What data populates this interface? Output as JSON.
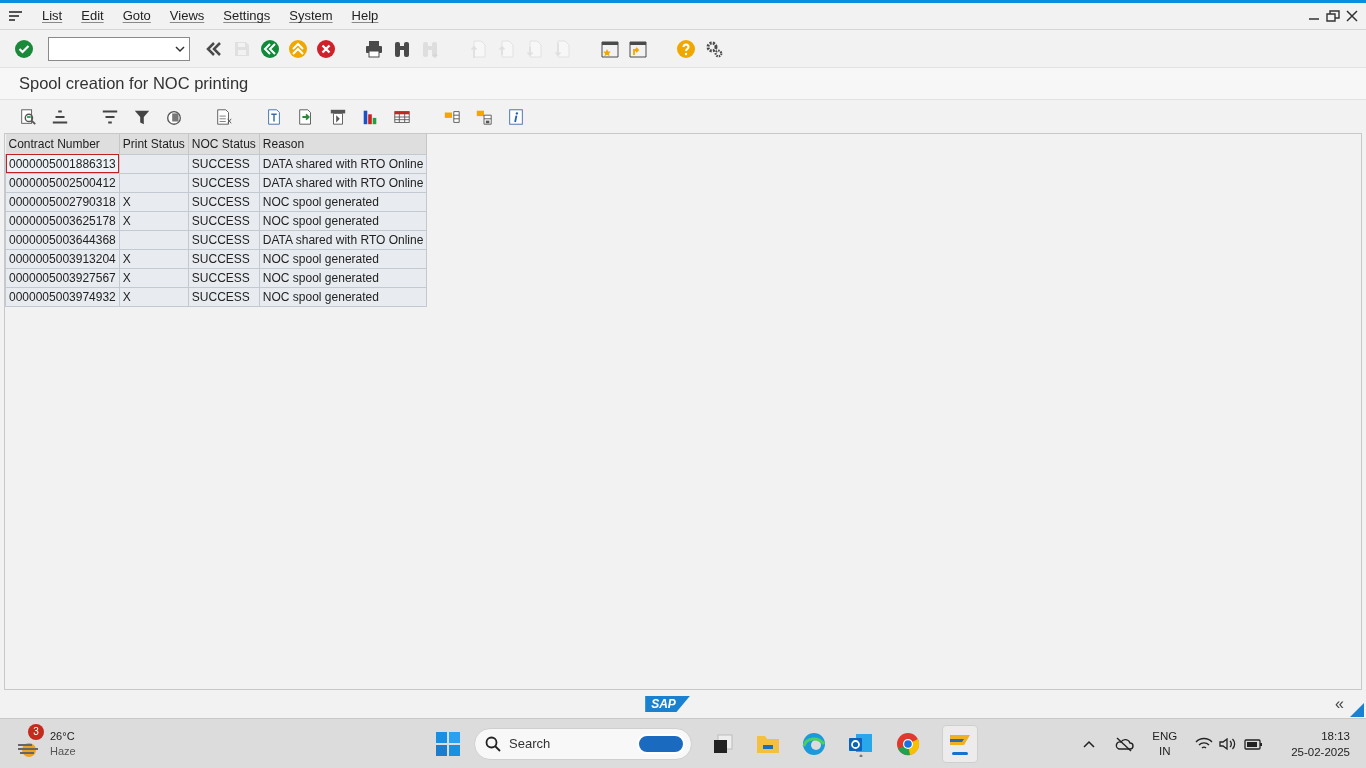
{
  "menu_bar": [
    "List",
    "Edit",
    "Goto",
    "Views",
    "Settings",
    "System",
    "Help"
  ],
  "toolbar": [
    {
      "kind": "check",
      "disabled": false
    },
    {
      "kind": "command-field",
      "disabled": false
    },
    {
      "kind": "collapse",
      "disabled": false
    },
    {
      "kind": "save",
      "disabled": true
    },
    {
      "kind": "back",
      "disabled": false
    },
    {
      "kind": "up",
      "disabled": false
    },
    {
      "kind": "cancel",
      "disabled": false
    },
    {
      "kind": "print",
      "disabled": false
    },
    {
      "kind": "find",
      "disabled": false
    },
    {
      "kind": "find-next",
      "disabled": true
    },
    {
      "kind": "first-page",
      "disabled": true
    },
    {
      "kind": "prev-page",
      "disabled": true
    },
    {
      "kind": "next-page",
      "disabled": true
    },
    {
      "kind": "last-page",
      "disabled": true
    },
    {
      "kind": "new-window",
      "disabled": false
    },
    {
      "kind": "shortcut",
      "disabled": false
    },
    {
      "kind": "help",
      "disabled": false
    },
    {
      "kind": "settings",
      "disabled": false
    }
  ],
  "title": "Spool creation for NOC printing",
  "table": {
    "columns": [
      "Contract Number",
      "Print Status",
      "NOC Status",
      "Reason"
    ],
    "rows": [
      {
        "cells": [
          "0000005001886313",
          "",
          "SUCCESS",
          "DATA shared with RTO Online"
        ],
        "focused": true
      },
      {
        "cells": [
          "0000005002500412",
          "",
          "SUCCESS",
          "DATA shared with RTO Online"
        ],
        "focused": false
      },
      {
        "cells": [
          "0000005002790318",
          "X",
          "SUCCESS",
          "NOC spool generated"
        ],
        "focused": false
      },
      {
        "cells": [
          "0000005003625178",
          "X",
          "SUCCESS",
          "NOC spool generated"
        ],
        "focused": false
      },
      {
        "cells": [
          "0000005003644368",
          "",
          "SUCCESS",
          "DATA shared with RTO Online"
        ],
        "focused": false
      },
      {
        "cells": [
          "0000005003913204",
          "X",
          "SUCCESS",
          "NOC spool generated"
        ],
        "focused": false
      },
      {
        "cells": [
          "0000005003927567",
          "X",
          "SUCCESS",
          "NOC spool generated"
        ],
        "focused": false
      },
      {
        "cells": [
          "0000005003974932",
          "X",
          "SUCCESS",
          "NOC spool generated"
        ],
        "focused": false
      }
    ]
  },
  "status_bar": {
    "logo": "SAP",
    "collapse": "«"
  },
  "taskbar": {
    "weather": {
      "badge": "3",
      "temperature": "26°C",
      "condition": "Haze"
    },
    "search": {
      "placeholder": "Search"
    },
    "language": "ENG",
    "region": "IN",
    "time": "18:13",
    "date": "25-02-2025"
  }
}
